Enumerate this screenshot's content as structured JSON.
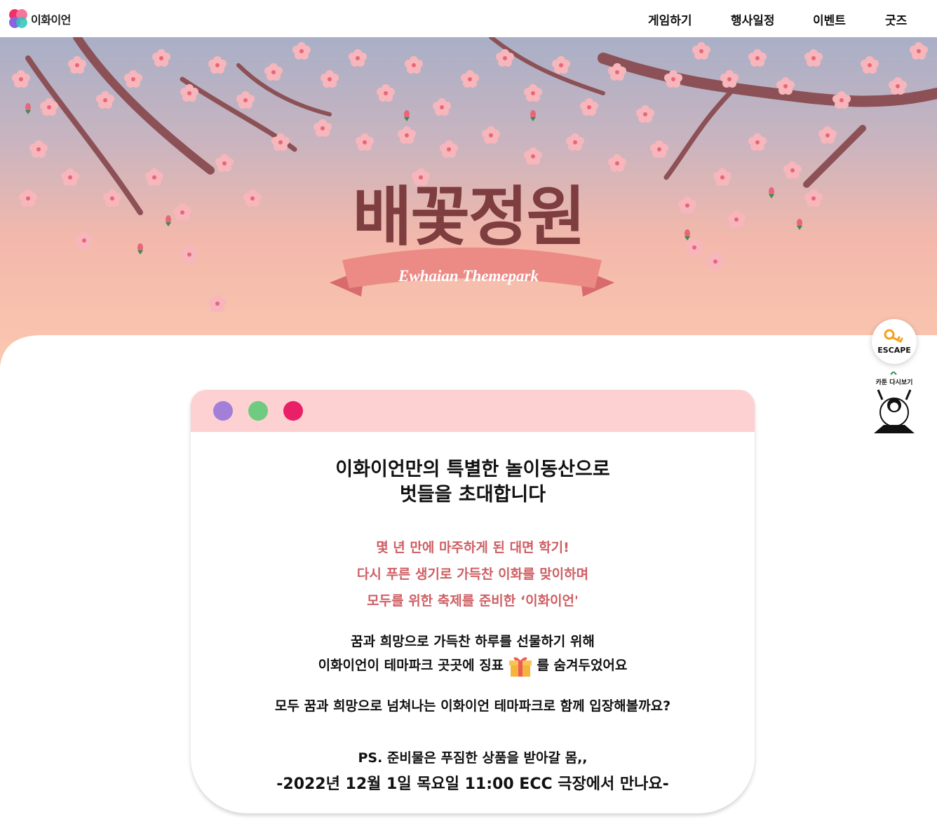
{
  "nav": {
    "brand": "이화이언",
    "items": [
      {
        "label": "게임하기"
      },
      {
        "label": "행사일정"
      },
      {
        "label": "이벤트"
      },
      {
        "label": "굿즈"
      }
    ]
  },
  "hero": {
    "title": "배꽃정원",
    "subtitle": "Ewhaian Themepark"
  },
  "side": {
    "escape_label": "ESCAPE",
    "cartoon_label": "카툰 다시보기"
  },
  "card": {
    "headline": [
      "이화이언만의 특별한 놀이동산으로",
      "벗들을 초대합니다"
    ],
    "pink_lines": [
      "몇 년 만에 마주하게 된 대면 학기!",
      "다시 푸른 생기로 가득찬 이화를 맞이하며",
      "모두를 위한 축제를 준비한 ‘이화이언'"
    ],
    "body_line1": "꿈과 희망으로 가득찬 하루를 선물하기 위해",
    "body_line2_before": "이화이언이 테마파크 곳곳에 징표",
    "body_line2_after": "를 숨겨두었어요",
    "invite": "모두 꿈과 희망으로 넘쳐나는 이화이언 테마파크로 함께 입장해볼까요?",
    "ps": "PS. 준비물은 푸짐한 상품을 받아갈 몸,,",
    "date": "-2022년 12월 1일 목요일 11:00 ECC 극장에서 만나요-"
  },
  "colors": {
    "card_bar": "#fdd1d2",
    "dot_purple": "#a47fd9",
    "dot_green": "#6fcb7f",
    "dot_pink": "#e91f68",
    "title": "#7e3d3f",
    "pink_text": "#cf5e63"
  },
  "icons": [
    "logo-heart-icon",
    "key-icon",
    "gift-icon",
    "cherry-blossom-illustration"
  ]
}
